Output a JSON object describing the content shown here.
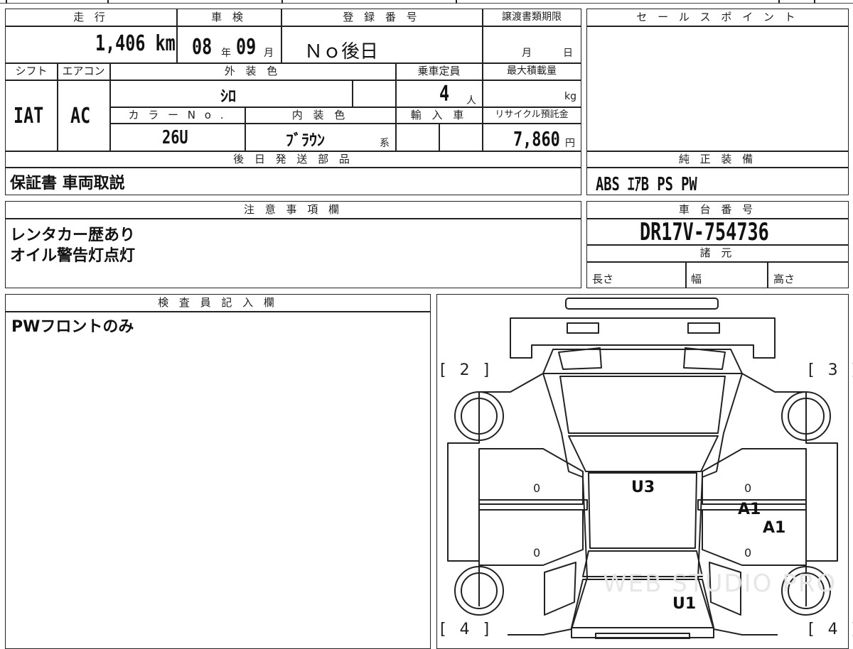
{
  "top": {
    "headers": {
      "mileage": "走 行",
      "inspection": "車 検",
      "registration": "登 録 番 号",
      "transfer_deadline": "譲渡書類期限",
      "shift": "シフト",
      "aircon": "エアコン",
      "exterior_color": "外 装 色",
      "capacity": "乗車定員",
      "max_load": "最大積載量",
      "color_no": "カ ラ ー N o .",
      "interior_color": "内 装 色",
      "import": "輸 入 車",
      "recycle": "リサイクル預託金",
      "later_parts": "後 日 発 送 部 品"
    },
    "mileage_value": "1,406 km",
    "inspection_year": "08",
    "inspection_year_unit": "年",
    "inspection_month": "09",
    "inspection_month_unit": "月",
    "registration_value": "Ｎｏ後日",
    "deadline_month_unit": "月",
    "deadline_day_unit": "日",
    "shift_value": "IAT",
    "aircon_value": "AC",
    "exterior_color_value": "ｼﾛ",
    "capacity_value": "4",
    "capacity_unit": "人",
    "max_load_unit": "kg",
    "color_no_value": "26U",
    "interior_color_value": "ﾌﾞﾗｳﾝ",
    "interior_color_suffix": "系",
    "recycle_value": "7,860",
    "recycle_unit": "円",
    "later_parts_value": "保証書 車両取説"
  },
  "right": {
    "sales_point_header": "セ ー ル ス ポ イ ン ト",
    "equipment_header": "純 正 装 備",
    "equipment_value": "ABS ｴｱB PS PW",
    "chassis_header": "車 台 番 号",
    "chassis_value": "DR17V-754736",
    "specs_header": "諸 元",
    "length_label": "長さ",
    "width_label": "幅",
    "height_label": "高さ"
  },
  "notes": {
    "header": "注 意 事 項 欄",
    "line1": "レンタカー歴あり",
    "line2": "オイル警告灯点灯"
  },
  "inspector": {
    "header": "検 査 員 記 入 欄",
    "text": "PWフロントのみ"
  },
  "diagram": {
    "corner_tl": "[ 2 ]",
    "corner_tr": "[ 3 ]",
    "corner_bl": "[ 4 ]",
    "corner_br": "[ 4 ]",
    "marks": [
      "U3",
      "A1",
      "A1",
      "U1"
    ],
    "zeros": [
      "0",
      "0",
      "0",
      "0"
    ],
    "watermark": "WEB STUDIO PRO"
  }
}
